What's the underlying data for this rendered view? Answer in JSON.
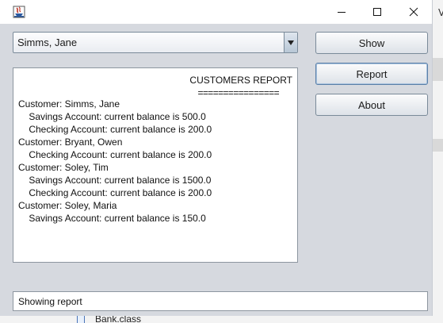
{
  "background_app": {
    "peek_letter": "V",
    "file_label": "Bank.class"
  },
  "window": {
    "title": "",
    "controls": {
      "minimize_icon": "minimize-icon",
      "maximize_icon": "maximize-icon",
      "close_icon": "close-icon"
    }
  },
  "customer_combo": {
    "selected": "Simms, Jane"
  },
  "buttons": {
    "show": "Show",
    "report": "Report",
    "about": "About"
  },
  "report": {
    "title": "CUSTOMERS REPORT",
    "underline": "================",
    "lines": [
      "Customer: Simms, Jane",
      "    Savings Account: current balance is 500.0",
      "    Checking Account: current balance is 200.0",
      "Customer: Bryant, Owen",
      "    Checking Account: current balance is 200.0",
      "Customer: Soley, Tim",
      "    Savings Account: current balance is 1500.0",
      "    Checking Account: current balance is 200.0",
      "Customer: Soley, Maria",
      "    Savings Account: current balance is 150.0"
    ]
  },
  "status": {
    "text": "Showing report"
  },
  "colors": {
    "client_background": "#d6d9df",
    "button_border": "#7a8a99",
    "focused_button_border": "#5a7fa8"
  }
}
